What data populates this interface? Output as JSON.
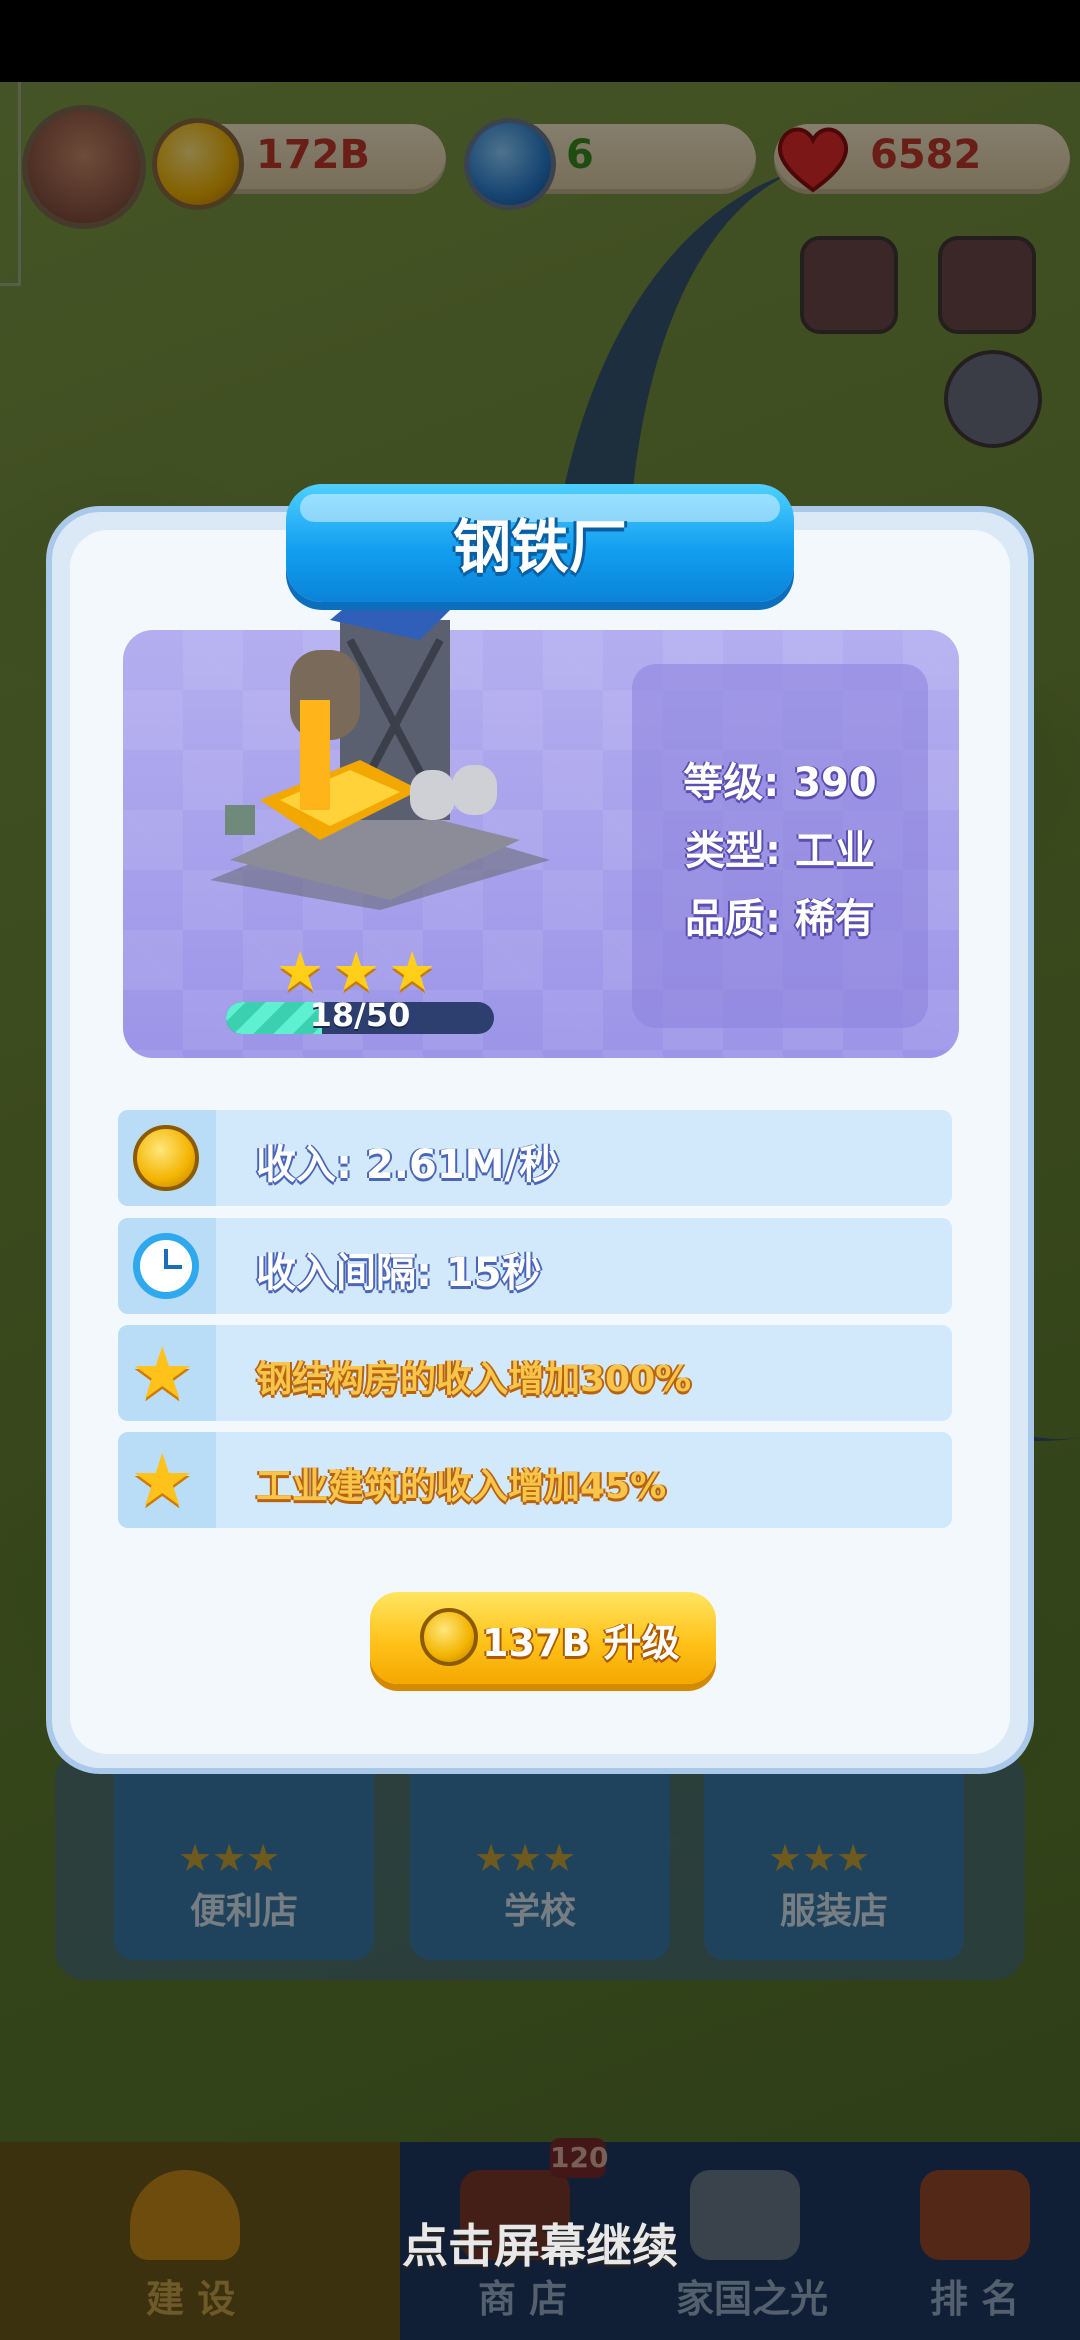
{
  "hud": {
    "coins": "172B",
    "gems": "6",
    "hearts": "6582",
    "colors": {
      "coins": "#c0392b",
      "gems": "#3a8a1e",
      "hearts": "#c0392b"
    }
  },
  "dialog": {
    "title": "钢铁厂",
    "stats": {
      "level": "等级: 390",
      "type": "类型: 工业",
      "quality": "品质: 稀有"
    },
    "stars": 3,
    "progress": {
      "text": "18/50",
      "current": 18,
      "max": 50
    },
    "rows": [
      {
        "icon": "coin-icon",
        "text": "收入: 2.61M/秒",
        "style": "blue"
      },
      {
        "icon": "clock-icon",
        "text": "收入间隔: 15秒",
        "style": "blue"
      },
      {
        "icon": "star-icon",
        "text": "钢结构房的收入增加300%",
        "style": "gold"
      },
      {
        "icon": "star-icon",
        "text": "工业建筑的收入增加45%",
        "style": "gold"
      }
    ],
    "upgrade": {
      "label": "137B 升级"
    }
  },
  "cards": [
    {
      "label": "便利店"
    },
    {
      "label": "学校"
    },
    {
      "label": "服装店"
    }
  ],
  "nav": {
    "items": [
      {
        "label": "建 设"
      },
      {
        "label": "商 店"
      },
      {
        "label": "家国之光"
      },
      {
        "label": "排 名"
      }
    ],
    "badge": "120"
  },
  "continue_hint": "点击屏幕继续"
}
